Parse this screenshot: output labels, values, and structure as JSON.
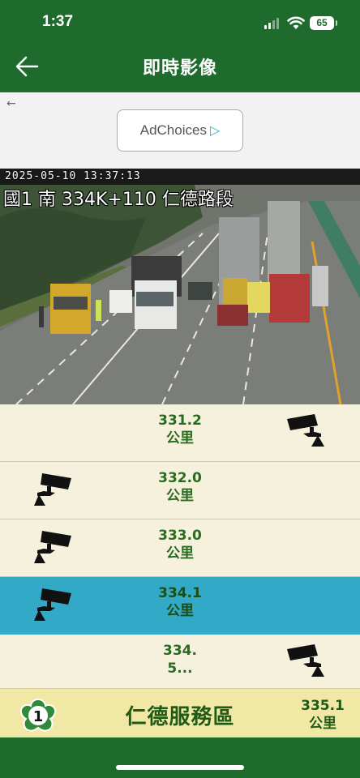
{
  "status": {
    "time": "1:37",
    "battery": "65"
  },
  "nav": {
    "title": "即時影像"
  },
  "ad": {
    "back": "←",
    "label": "AdChoices"
  },
  "camera": {
    "timestamp": "2025-05-10 13:37:13",
    "location": "國1 南 334K+110 仁德路段"
  },
  "cameras": [
    {
      "km": "331.2",
      "unit": "公里",
      "icon_side": "right",
      "active": false
    },
    {
      "km": "332.0",
      "unit": "公里",
      "icon_side": "left",
      "active": false
    },
    {
      "km": "333.0",
      "unit": "公里",
      "icon_side": "left",
      "active": false
    },
    {
      "km": "334.1",
      "unit": "公里",
      "icon_side": "left",
      "active": true
    },
    {
      "km": "334.",
      "unit": "5...",
      "icon_side": "right",
      "active": false
    }
  ],
  "service_area": {
    "shield_number": "1",
    "name": "仁德服務區",
    "km": "335.1",
    "unit": "公里"
  },
  "colors": {
    "header_green": "#1f6b2e",
    "row_bg": "#f5f1dc",
    "active_row": "#31a9c7",
    "service_bg": "#f2e8a6",
    "text_green": "#2a6a21"
  }
}
